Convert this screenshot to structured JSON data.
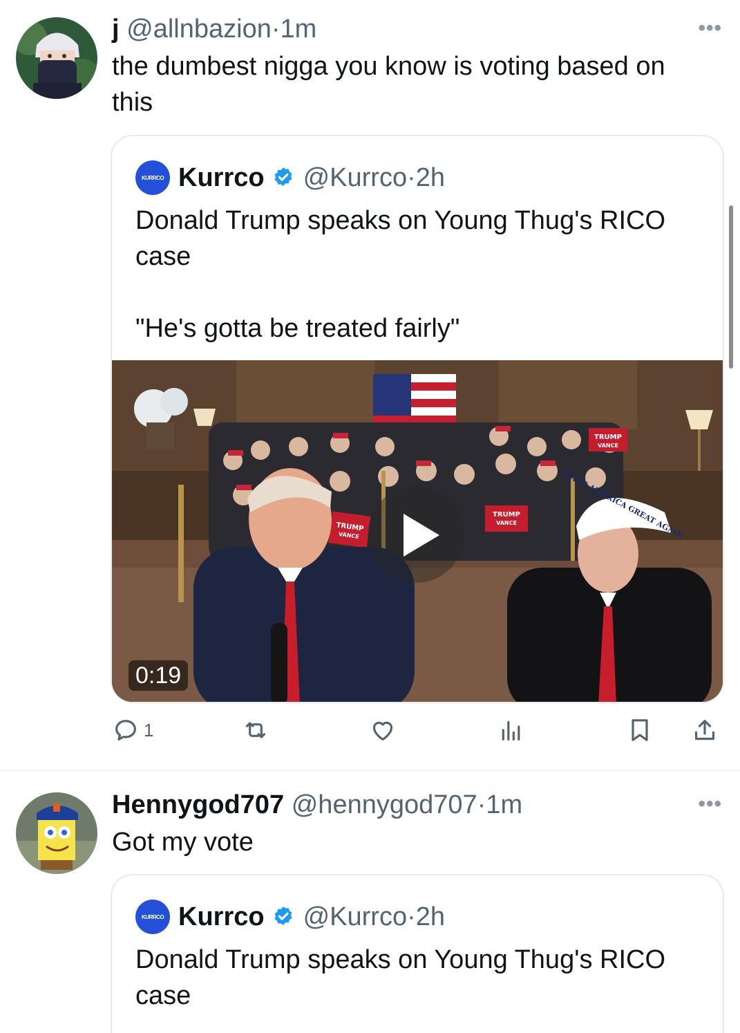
{
  "tweets": [
    {
      "author_name": "j",
      "handle": "@allnbazion",
      "separator": "·",
      "time": "1m",
      "text": "the dumbest nigga you know is voting based on\nthis",
      "more_icon": "more-horizontal-icon",
      "quote": {
        "author_name": "Kurrco",
        "handle": "@Kurrco",
        "time": "2h",
        "text": "Donald Trump speaks on Young Thug's RICO\ncase\n\n\"He's gotta be treated fairly\"",
        "video_duration": "0:19"
      },
      "actions": {
        "reply_count": "1"
      }
    },
    {
      "author_name": "Hennygod707",
      "handle": "@hennygod707",
      "separator": "·",
      "time": "1m",
      "text": "Got my vote",
      "quote": {
        "author_name": "Kurrco",
        "handle": "@Kurrco",
        "time": "2h",
        "text": "Donald Trump speaks on Young Thug's RICO\ncase"
      }
    }
  ],
  "video_signs": {
    "sign1": "TRUMP",
    "sign1b": "VANCE",
    "sign2": "TRUMP",
    "sign2b": "VANCE",
    "sign3": "TRUMP",
    "sign3b": "VANCE",
    "hat": "MAKE AMERICA GREAT AGAIN"
  },
  "colors": {
    "verified": "#1d9bf0",
    "brand_avatar": "#2450d8",
    "muted_text": "#536471"
  }
}
